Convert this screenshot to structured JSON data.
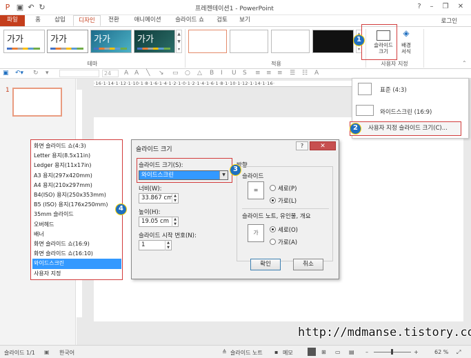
{
  "window": {
    "title": "프레젠테이션1 - PowerPoint",
    "minimize": "–",
    "restore": "❐",
    "close": "✕",
    "help": "?"
  },
  "quick_access": {
    "save_icon": "save-icon",
    "undo_icon": "undo-icon",
    "redo_icon": "redo-icon"
  },
  "tabs": [
    {
      "label": "파일"
    },
    {
      "label": "홈"
    },
    {
      "label": "삽입"
    },
    {
      "label": "디자인"
    },
    {
      "label": "전환"
    },
    {
      "label": "애니메이션"
    },
    {
      "label": "슬라이드 쇼"
    },
    {
      "label": "검토"
    },
    {
      "label": "보기"
    }
  ],
  "account": "로그인",
  "ribbon": {
    "themes": [
      {
        "label": "가가"
      },
      {
        "label": "가가"
      },
      {
        "label": "가가"
      },
      {
        "label": "가가"
      }
    ],
    "themes_group": "테마",
    "variants_group": "적용",
    "slide_size_button": "슬라이드\n크기",
    "format_bg_button": "배경\n서식",
    "customize_group": "사용자 지정"
  },
  "format_bar": {
    "font_size": "24"
  },
  "thumbnail": {
    "number": "1"
  },
  "ruler": {
    "horizontal": "·16·1·14·1·12·1·10·1·8·1·6·1·4·1·2·1·0·1·2·1·4·1·6·1·8·1·10·1·12·1·14·1·16·"
  },
  "size_menu": {
    "items": [
      {
        "label": "표준 (4:3)"
      },
      {
        "label": "와이드스크린 (16:9)"
      }
    ],
    "custom": "사용자 지정 슬라이드 크기(C)..."
  },
  "page_list": {
    "items": [
      "화면 슬라이드 쇼(4:3)",
      "Letter 용지(8.5x11in)",
      "Ledger 용지(11x17in)",
      "A3 용지(297x420mm)",
      "A4 용지(210x297mm)",
      "B4(ISO) 용지(250x353mm)",
      "B5 (ISO) 용지(176x250mm)",
      "35mm 슬라이드",
      "오버헤드",
      "배너",
      "화면 슬라이드 쇼(16:9)",
      "화면 슬라이드 쇼(16:10)",
      "와이드스크린",
      "사용자 지정"
    ],
    "selected_index": 12
  },
  "dialog": {
    "title": "슬라이드 크기",
    "size_label": "슬라이드 크기(S):",
    "size_value": "와이드스크린",
    "width_label": "너비(W):",
    "width_value": "33.867 cm",
    "height_label": "높이(H):",
    "height_value": "19.05 cm",
    "start_label": "슬라이드 시작 번호(N):",
    "start_value": "1",
    "orientation_label": "방향",
    "slides_label": "슬라이드",
    "slides_portrait": "세로(P)",
    "slides_landscape": "가로(L)",
    "notes_label": "슬라이드 노트, 유인물, 개요",
    "notes_portrait": "세로(O)",
    "notes_landscape": "가로(A)",
    "ok": "확인",
    "cancel": "취소"
  },
  "callouts": [
    "1",
    "2",
    "3",
    "4"
  ],
  "status": {
    "slide": "슬라이드 1/1",
    "language": "한국어",
    "notes": "슬라이드 노트",
    "comments": "메모",
    "zoom": "62 %"
  },
  "watermark": "http://mdmanse.tistory.com",
  "colors": {
    "accent": "#c43e1c",
    "callout": "#1f6fc0",
    "highlight": "#d23b3b",
    "selection": "#3399ff"
  }
}
